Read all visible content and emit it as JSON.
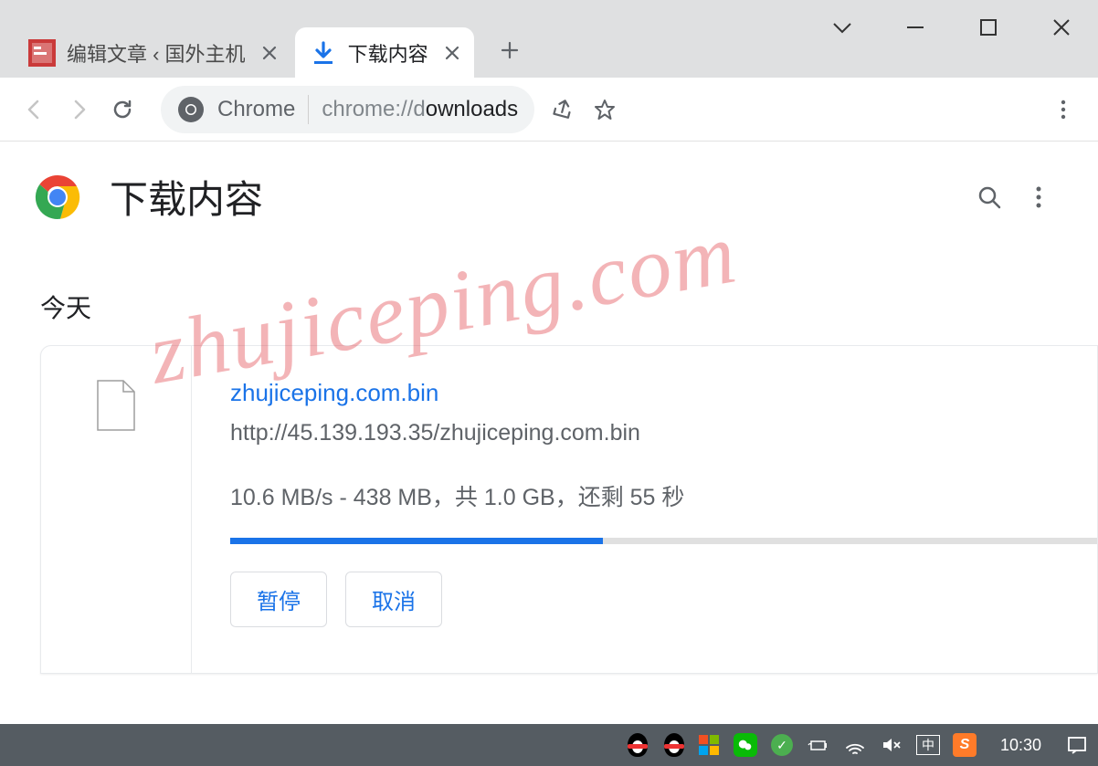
{
  "tabs": [
    {
      "title": "编辑文章 ‹ 国外主机"
    },
    {
      "title": "下载内容"
    }
  ],
  "address": {
    "label": "Chrome",
    "url_prefix": "chrome://d",
    "url_suffix": "ownloads"
  },
  "page": {
    "title": "下载内容",
    "section": "今天"
  },
  "download": {
    "filename": "zhujiceping.com.bin",
    "url": "http://45.139.193.35/zhujiceping.com.bin",
    "status": "10.6 MB/s - 438 MB，共 1.0 GB，还剩 55 秒",
    "progress_percent": 43,
    "pause_label": "暂停",
    "cancel_label": "取消"
  },
  "watermark": "zhujiceping.com",
  "taskbar": {
    "ime": "中",
    "sogou": "S",
    "clock": "10:30"
  }
}
